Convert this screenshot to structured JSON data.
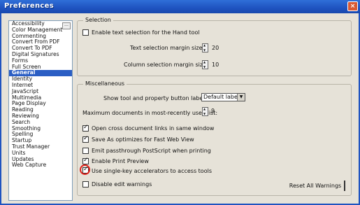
{
  "window": {
    "title": "Preferences",
    "close_label": "×"
  },
  "sidebar": {
    "scroll_label": "…",
    "items": [
      "Accessibility",
      "Color Management",
      "Commenting",
      "Convert From PDF",
      "Convert To PDF",
      "Digital Signatures",
      "Forms",
      "Full Screen",
      "General",
      "Identity",
      "Internet",
      "JavaScript",
      "Multimedia",
      "Page Display",
      "Reading",
      "Reviewing",
      "Search",
      "Smoothing",
      "Spelling",
      "Startup",
      "Trust Manager",
      "Units",
      "Updates",
      "Web Capture"
    ],
    "selected_index": 8
  },
  "selection": {
    "title": "Selection",
    "enable_text_selection_label": "Enable text selection for the Hand tool",
    "enable_text_selection_checked": false,
    "text_margin_label": "Text selection margin size:",
    "text_margin_value": "20",
    "column_margin_label": "Column selection margin size:",
    "column_margin_value": "10"
  },
  "misc": {
    "title": "Miscellaneous",
    "show_tool_label": "Show tool and property button labels:",
    "show_tool_value": "Default labels",
    "max_docs_label": "Maximum documents in most-recently used list:",
    "max_docs_value": "9",
    "checkboxes": [
      {
        "label": "Open cross document links in same window",
        "checked": true
      },
      {
        "label": "Save As optimizes for Fast Web View",
        "checked": true
      },
      {
        "label": "Emit passthrough PostScript when printing",
        "checked": false
      },
      {
        "label": "Enable Print Preview",
        "checked": true
      },
      {
        "label": "Use single-key accelerators to access tools",
        "checked": true
      },
      {
        "label": "Disable edit warnings",
        "checked": false
      }
    ],
    "reset_label": "Reset All Warnings"
  },
  "colors": {
    "title_bar": "#1f53c0",
    "selected_item": "#2b5ec4",
    "highlight": "#e0201a"
  }
}
